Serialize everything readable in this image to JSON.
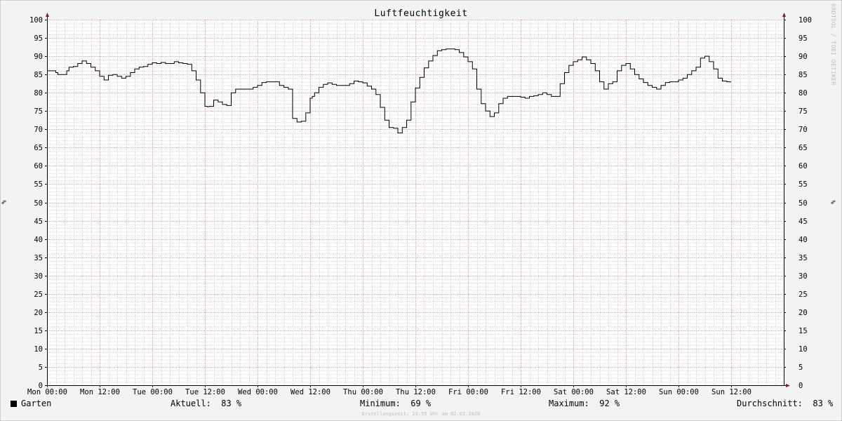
{
  "chart_data": {
    "type": "line",
    "title": "Luftfeuchtigkeit",
    "ylabel": "%",
    "ylim": [
      0,
      100
    ],
    "yticks": [
      0,
      5,
      10,
      15,
      20,
      25,
      30,
      35,
      40,
      45,
      50,
      55,
      60,
      65,
      70,
      75,
      80,
      85,
      90,
      95,
      100
    ],
    "xlim_hours": [
      0,
      168
    ],
    "xticks": [
      {
        "hour": 0,
        "label": "Mon 00:00"
      },
      {
        "hour": 12,
        "label": "Mon 12:00"
      },
      {
        "hour": 24,
        "label": "Tue 00:00"
      },
      {
        "hour": 36,
        "label": "Tue 12:00"
      },
      {
        "hour": 48,
        "label": "Wed 00:00"
      },
      {
        "hour": 60,
        "label": "Wed 12:00"
      },
      {
        "hour": 72,
        "label": "Thu 00:00"
      },
      {
        "hour": 84,
        "label": "Thu 12:00"
      },
      {
        "hour": 96,
        "label": "Fri 00:00"
      },
      {
        "hour": 108,
        "label": "Fri 12:00"
      },
      {
        "hour": 120,
        "label": "Sat 00:00"
      },
      {
        "hour": 132,
        "label": "Sat 12:00"
      },
      {
        "hour": 144,
        "label": "Sun 00:00"
      },
      {
        "hour": 156,
        "label": "Sun 12:00"
      }
    ],
    "grid": true,
    "series": [
      {
        "name": "Garten",
        "color": "#000000",
        "hours": [
          0,
          2,
          2.5,
          4,
          4.5,
          5,
          6,
          7,
          8,
          9,
          10,
          11,
          12,
          13,
          14,
          15,
          16,
          17,
          18,
          19,
          20,
          21,
          22,
          23,
          24,
          25,
          26,
          27,
          28,
          29,
          30,
          31,
          32,
          33,
          34,
          35,
          36,
          36.5,
          37,
          38,
          39,
          40,
          41,
          42,
          43,
          44,
          45,
          46,
          47,
          48,
          49,
          50,
          51,
          52,
          53,
          54,
          55,
          56,
          57,
          58,
          59,
          60,
          60.5,
          61,
          62,
          63,
          64,
          65,
          66,
          67,
          68,
          69,
          70,
          71,
          72,
          73,
          74,
          75,
          76,
          77,
          78,
          79,
          80,
          81,
          82,
          83,
          84,
          85,
          86,
          87,
          88,
          89,
          90,
          91,
          92,
          93,
          94,
          95,
          96,
          97,
          98,
          99,
          100,
          101,
          102,
          103,
          104,
          105,
          106,
          107,
          108,
          109,
          110,
          111,
          112,
          113,
          114,
          115,
          116,
          117,
          118,
          119,
          120,
          121,
          122,
          123,
          124,
          125,
          126,
          127,
          128,
          129,
          130,
          131,
          132,
          133,
          134,
          135,
          136,
          137,
          138,
          139,
          140,
          141,
          142,
          143,
          144,
          145,
          146,
          147,
          148,
          149,
          150,
          151,
          152,
          153,
          154,
          155,
          156,
          157,
          158,
          159,
          160,
          161,
          162,
          163,
          164,
          165,
          166,
          167
        ],
        "values": [
          86,
          85.5,
          85,
          85,
          86,
          87,
          87.2,
          88,
          88.7,
          88,
          87,
          86,
          84.5,
          83.5,
          84.8,
          85,
          84.5,
          84,
          84.5,
          85.5,
          86.5,
          87,
          87.2,
          87.8,
          88.2,
          88,
          88.3,
          88,
          88,
          88.5,
          88.2,
          88,
          87.8,
          86,
          83.5,
          80,
          76.3,
          76.2,
          76.3,
          78,
          77.5,
          76.8,
          76.5,
          80,
          81,
          81,
          81,
          81,
          81.5,
          82,
          82.8,
          83,
          83,
          83,
          82,
          81.5,
          81,
          73,
          72,
          72.2,
          74.5,
          78.5,
          79,
          80,
          81.5,
          82.3,
          82.7,
          82.3,
          82,
          82,
          82,
          82.5,
          83.2,
          83,
          82.7,
          81.8,
          81,
          79.5,
          76,
          72.5,
          70.5,
          70.3,
          69,
          70.5,
          72.5,
          77.5,
          81.3,
          84.2,
          86.8,
          88.7,
          90.2,
          91.5,
          91.8,
          92,
          92,
          91.8,
          91,
          89.8,
          88.5,
          86.5,
          81,
          77,
          75,
          73.5,
          74.5,
          77,
          78.5,
          79,
          79,
          79,
          78.8,
          78.5,
          79,
          79.2,
          79.5,
          80,
          79.5,
          79,
          79,
          82.5,
          85.5,
          87.5,
          88.5,
          89,
          89.8,
          89,
          88,
          86,
          83,
          81,
          82.5,
          83,
          86,
          87.5,
          88,
          86.5,
          85,
          83.8,
          82.8,
          82,
          81.5,
          81,
          82,
          82.8,
          83,
          83,
          83.5,
          84,
          85,
          86,
          87,
          89.5,
          90,
          88.5,
          86.5,
          84,
          83.2,
          83
        ]
      }
    ]
  },
  "watermark": "RRDTOOL / TOBI OETIKER",
  "legend": {
    "series_name": "Garten",
    "current_label": "Aktuell:",
    "current_value": "83 %",
    "min_label": "Minimum:",
    "min_value": "69 %",
    "max_label": "Maximum:",
    "max_value": "92 %",
    "avg_label": "Durchschnitt:",
    "avg_value": "83 %"
  },
  "footer": "Erstellungszeit: 23:55 Uhr am 02.02.2020"
}
